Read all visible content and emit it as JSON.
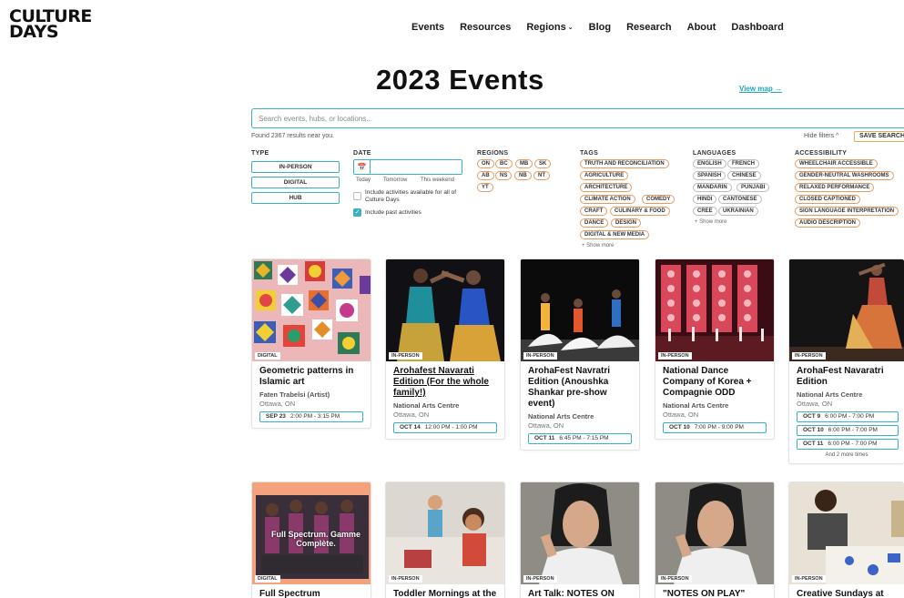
{
  "logo": {
    "line1": "CULTURE",
    "line2": "DAYS"
  },
  "nav": {
    "items": [
      "Events",
      "Resources",
      "Regions",
      "Blog",
      "Research",
      "About",
      "Dashboard"
    ]
  },
  "page": {
    "title": "2023 Events",
    "view_map": "View map →"
  },
  "search": {
    "placeholder": "Search events, hubs, or locations...",
    "value": ""
  },
  "results": {
    "found": "Found 2367 results near you.",
    "hide_filters": "Hide filters ^",
    "save_search": "SAVE SEARCH"
  },
  "filters": {
    "type": {
      "label": "TYPE",
      "options": [
        "IN-PERSON",
        "DIGITAL",
        "HUB"
      ]
    },
    "date": {
      "label": "DATE",
      "quick": [
        "Today",
        "Tomorrow",
        "This weekend"
      ],
      "include_all": "Include activities available for all of Culture Days",
      "include_past": "Include past activities"
    },
    "regions": {
      "label": "REGIONS",
      "options": [
        "ON",
        "BC",
        "MB",
        "SK",
        "AB",
        "NS",
        "NB",
        "NT",
        "YT"
      ]
    },
    "tags": {
      "label": "TAGS",
      "options": [
        "TRUTH AND RECONCILIATION",
        "AGRICULTURE",
        "ARCHITECTURE",
        "CLIMATE ACTION",
        "COMEDY",
        "CRAFT",
        "CULINARY & FOOD",
        "DANCE",
        "DESIGN",
        "DIGITAL & NEW MEDIA"
      ],
      "show_more": "+ Show more"
    },
    "languages": {
      "label": "LANGUAGES",
      "options": [
        "ENGLISH",
        "FRENCH",
        "SPANISH",
        "CHINESE",
        "MANDARIN",
        "PUNJABI",
        "HINDI",
        "CANTONESE",
        "CREE",
        "UKRAINIAN"
      ],
      "show_more": "+ Show more"
    },
    "accessibility": {
      "label": "ACCESSIBILITY",
      "options": [
        "WHEELCHAIR ACCESSIBLE",
        "GENDER-NEUTRAL WASHROOMS",
        "RELAXED PERFORMANCE",
        "CLOSED CAPTIONED",
        "SIGN LANGUAGE INTERPRETATION",
        "AUDIO DESCRIPTION"
      ]
    }
  },
  "cards": [
    {
      "badge": "DIGITAL",
      "title": "Geometric patterns in Islamic art",
      "org": "Faten Trabelsi (Artist)",
      "loc": "Ottawa, ON",
      "dates": [
        {
          "d": "SEP 23",
          "t": "2:00 PM - 3:15 PM"
        }
      ]
    },
    {
      "badge": "IN-PERSON",
      "title": "Arohafest Navarati Edition (For the whole family!)",
      "org": "National Arts Centre",
      "loc": "Ottawa, ON",
      "dates": [
        {
          "d": "OCT 14",
          "t": "12:00 PM - 1:00 PM"
        }
      ]
    },
    {
      "badge": "IN-PERSON",
      "title": "ArohaFest Navratri Edition (Anoushka Shankar pre-show event)",
      "org": "National Arts Centre",
      "loc": "Ottawa, ON",
      "dates": [
        {
          "d": "OCT 11",
          "t": "6:45 PM - 7:15 PM"
        }
      ]
    },
    {
      "badge": "IN-PERSON",
      "title": "National Dance Company of Korea + Compagnie ODD",
      "org": "National Arts Centre",
      "loc": "Ottawa, ON",
      "dates": [
        {
          "d": "OCT 10",
          "t": "7:00 PM - 9:00 PM"
        }
      ]
    },
    {
      "badge": "IN-PERSON",
      "title": "ArohaFest Navaratri Edition",
      "org": "National Arts Centre",
      "loc": "Ottawa, ON",
      "dates": [
        {
          "d": "OCT 9",
          "t": "6:00 PM - 7:00 PM"
        },
        {
          "d": "OCT 10",
          "t": "6:00 PM - 7:00 PM"
        },
        {
          "d": "OCT 11",
          "t": "6:00 PM - 7:00 PM"
        }
      ],
      "more": "And 2 more times"
    },
    {
      "badge": "DIGITAL",
      "title": "Full Spectrum",
      "overlay": "Full Spectrum. Gamme Complète."
    },
    {
      "badge": "IN-PERSON",
      "title": "Toddler Mornings at the"
    },
    {
      "badge": "IN-PERSON",
      "title": "Art Talk: NOTES ON"
    },
    {
      "badge": "IN-PERSON",
      "title": "\"NOTES ON PLAY\""
    },
    {
      "badge": "IN-PERSON",
      "title": "Creative Sundays at the"
    }
  ]
}
